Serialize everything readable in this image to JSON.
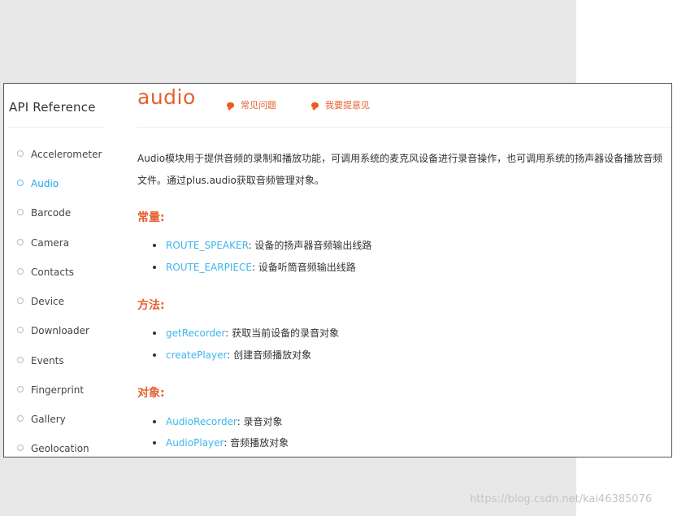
{
  "sidebar": {
    "title": "API Reference",
    "items": [
      {
        "label": "Accelerometer"
      },
      {
        "label": "Audio"
      },
      {
        "label": "Barcode"
      },
      {
        "label": "Camera"
      },
      {
        "label": "Contacts"
      },
      {
        "label": "Device"
      },
      {
        "label": "Downloader"
      },
      {
        "label": "Events"
      },
      {
        "label": "Fingerprint"
      },
      {
        "label": "Gallery"
      },
      {
        "label": "Geolocation"
      }
    ],
    "active_item": "Audio"
  },
  "header": {
    "title": "audio",
    "links": [
      {
        "label": "常见问题",
        "icon": "speech-bubble-icon"
      },
      {
        "label": "我要提意见",
        "icon": "speech-bubble-icon"
      }
    ]
  },
  "content": {
    "description_line1": "Audio模块用于提供音频的录制和播放功能，可调用系统的麦克风设备进行录音操作，也可调用系统的扬声器设备播放音频",
    "description_line2": "文件。通过plus.audio获取音频管理对象。",
    "sections": [
      {
        "heading": "常量:",
        "items": [
          {
            "link": "ROUTE_SPEAKER",
            "text": ": 设备的扬声器音频输出线路"
          },
          {
            "link": "ROUTE_EARPIECE",
            "text": ": 设备听筒音频输出线路"
          }
        ]
      },
      {
        "heading": "方法:",
        "items": [
          {
            "link": "getRecorder",
            "text": ": 获取当前设备的录音对象"
          },
          {
            "link": "createPlayer",
            "text": ": 创建音频播放对象"
          }
        ]
      },
      {
        "heading": "对象:",
        "items": [
          {
            "link": "AudioRecorder",
            "text": ": 录音对象"
          },
          {
            "link": "AudioPlayer",
            "text": ": 音频播放对象"
          }
        ]
      }
    ]
  },
  "watermark": "https://blog.csdn.net/kai46385076",
  "colors": {
    "accent": "#e4622f",
    "link": "#3cb5ec",
    "active_nav": "#1ea6ec",
    "outer_background": "#e8e8e8"
  }
}
